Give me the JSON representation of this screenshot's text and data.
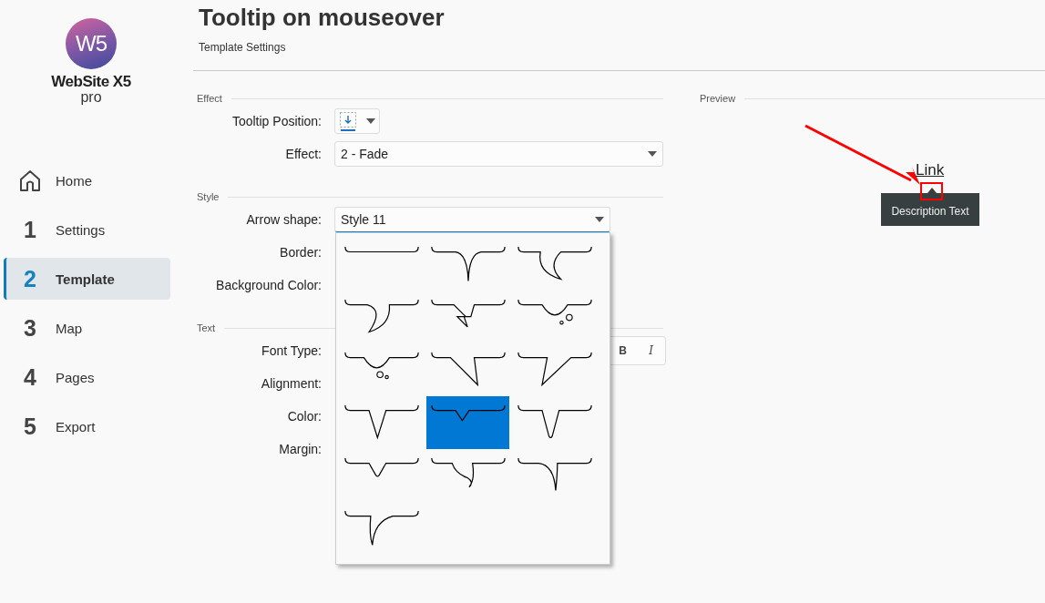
{
  "logo": {
    "mark": "W5",
    "name": "WebSite X5",
    "edition": "pro"
  },
  "nav": [
    {
      "kind": "home",
      "label": "Home",
      "selected": false
    },
    {
      "kind": "step",
      "number": "1",
      "label": "Settings",
      "selected": false
    },
    {
      "kind": "step",
      "number": "2",
      "label": "Template",
      "selected": true
    },
    {
      "kind": "step",
      "number": "3",
      "label": "Map",
      "selected": false
    },
    {
      "kind": "step",
      "number": "4",
      "label": "Pages",
      "selected": false
    },
    {
      "kind": "step",
      "number": "5",
      "label": "Export",
      "selected": false
    }
  ],
  "header": {
    "title": "Tooltip on mouseover",
    "subtitle": "Template Settings"
  },
  "sections": [
    {
      "title": "Effect",
      "rows": [
        {
          "kind": "icon-dropdown",
          "label": "Tooltip Position:"
        },
        {
          "kind": "dropdown",
          "label": "Effect:",
          "value": "2 - Fade"
        }
      ]
    },
    {
      "title": "Style",
      "rows": [
        {
          "kind": "open-dropdown",
          "label": "Arrow shape:",
          "value": "Style 11"
        },
        {
          "kind": "hidden",
          "label": "Border:"
        },
        {
          "kind": "hidden",
          "label": "Background Color:"
        }
      ]
    },
    {
      "title": "Text",
      "rows": [
        {
          "kind": "font",
          "label": "Font Type:",
          "bold_button": "B",
          "italic_button": "I"
        },
        {
          "kind": "hidden",
          "label": "Alignment:"
        },
        {
          "kind": "hidden",
          "label": "Color:"
        },
        {
          "kind": "hidden",
          "label": "Margin:"
        }
      ]
    }
  ],
  "arrow_shapes": [
    {
      "kind": "none",
      "selected": false
    },
    {
      "kind": "curve",
      "selected": false
    },
    {
      "kind": "bubble-right",
      "selected": false
    },
    {
      "kind": "bubble-left",
      "selected": false
    },
    {
      "kind": "zigzag",
      "selected": false
    },
    {
      "kind": "thought-right",
      "selected": false
    },
    {
      "kind": "thought-left",
      "selected": false
    },
    {
      "kind": "slant-right",
      "selected": false
    },
    {
      "kind": "slant-left",
      "selected": false
    },
    {
      "kind": "triangle",
      "selected": false
    },
    {
      "kind": "small-triangle",
      "selected": true
    },
    {
      "kind": "rounded-triangle",
      "selected": false
    },
    {
      "kind": "small-rounded",
      "selected": false
    },
    {
      "kind": "wave",
      "selected": false
    },
    {
      "kind": "curve-right",
      "selected": false
    },
    {
      "kind": "curve-left",
      "selected": false
    }
  ],
  "preview": {
    "title": "Preview",
    "link": "Link",
    "tooltip": "Description Text"
  }
}
